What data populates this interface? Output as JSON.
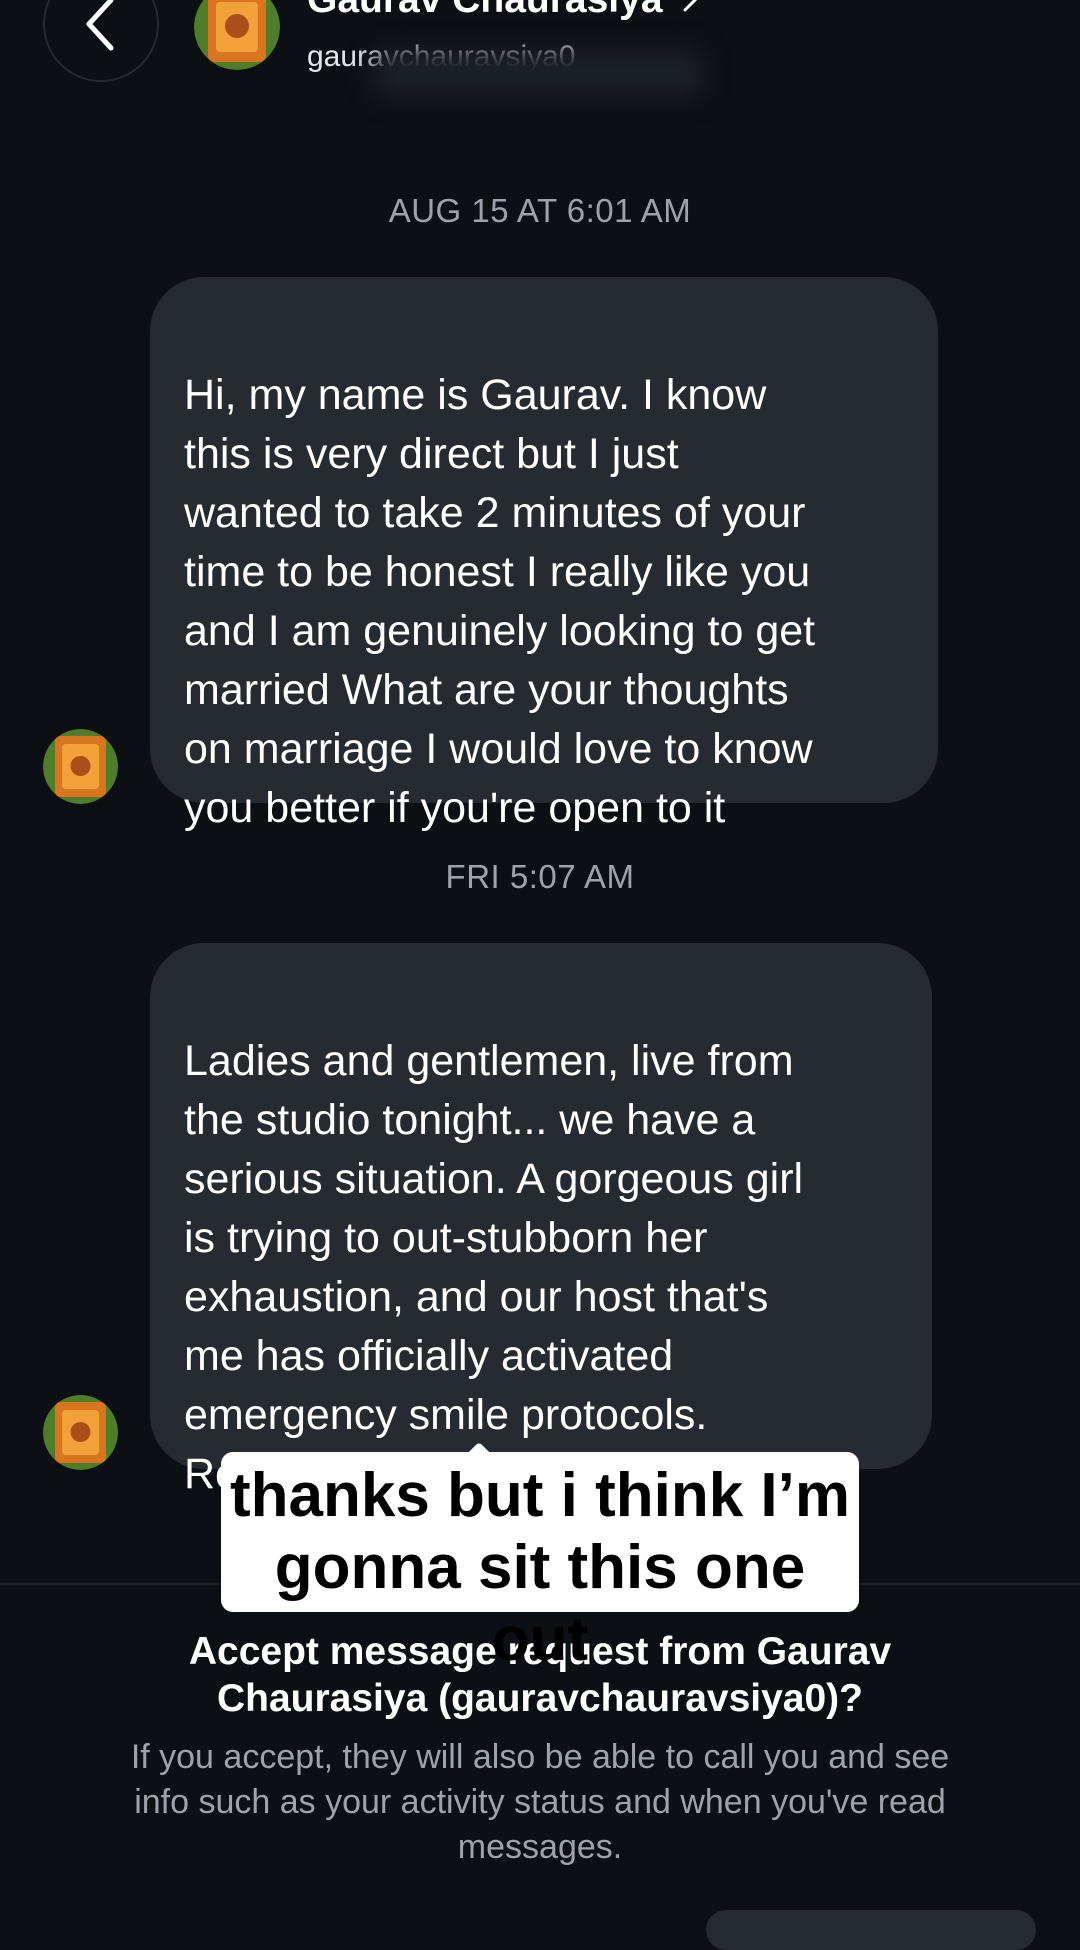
{
  "header": {
    "name": "Gaurav Chaurasiya",
    "username": "gauravchauravsiya0"
  },
  "conversation": {
    "messages": [
      {
        "timestamp": "AUG 15 AT 6:01 AM",
        "text": "Hi, my name is Gaurav. I know\nthis is very direct but I just\nwanted to take 2 minutes of your\ntime to be honest I really like you\nand I am genuinely looking to get\nmarried What are your thoughts\non marriage I would love to know\nyou better if you're open to it"
      },
      {
        "timestamp": "FRI 5:07 AM",
        "text": "Ladies and gentlemen, live from\nthe studio tonight... we have a\nserious situation. A gorgeous girl\nis trying to out-stubborn her\nexhaustion, and our host  that's\nme has officially activated\nemergency smile protocols.\nReady to play",
        "trailing_glyph": "?"
      }
    ]
  },
  "overlay_caption": "thanks but i think I’m\ngonna sit this one out",
  "request": {
    "title": "Accept message request from Gaurav\nChaurasiya (gauravchauravsiya0)?",
    "description": "If you accept, they will also be able to call you and see\ninfo such as your activity status and when you've read\nmessages."
  },
  "colors": {
    "background": "#0c0f14",
    "bubble": "#262a31",
    "muted_text": "#9ea3ab"
  }
}
